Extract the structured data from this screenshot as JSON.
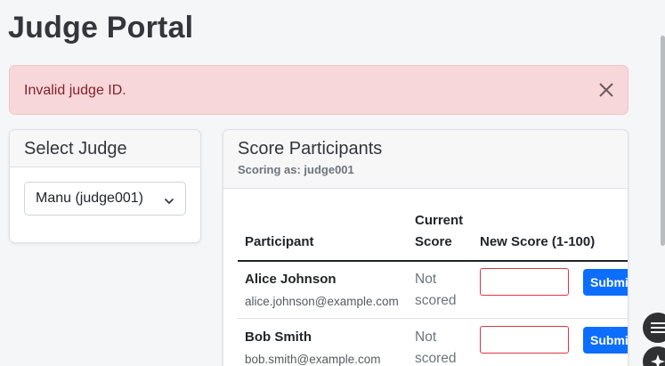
{
  "page": {
    "title": "Judge Portal"
  },
  "alert": {
    "message": "Invalid judge ID."
  },
  "select_card": {
    "title": "Select Judge",
    "selected_option": "Manu (judge001)"
  },
  "score_card": {
    "title": "Score Participants",
    "subtitle": "Scoring as: judge001",
    "columns": {
      "participant": "Participant",
      "current_score_line1": "Current",
      "current_score_line2": "Score",
      "new_score": "New Score (1-100)"
    },
    "rows": [
      {
        "name": "Alice Johnson",
        "email": "alice.johnson@example.com",
        "score_line1": "Not",
        "score_line2": "scored",
        "button": "Submit"
      },
      {
        "name": "Bob Smith",
        "email": "bob.smith@example.com",
        "score_line1": "Not",
        "score_line2": "scored",
        "button": "Submit"
      }
    ]
  },
  "colors": {
    "alert_bg": "#f8d7da",
    "alert_text": "#842029",
    "primary": "#0d6efd",
    "invalid_border": "#dc3545"
  },
  "icons": [
    "close-icon",
    "chevron-down-icon",
    "quote-icon",
    "sparkle-icon"
  ]
}
